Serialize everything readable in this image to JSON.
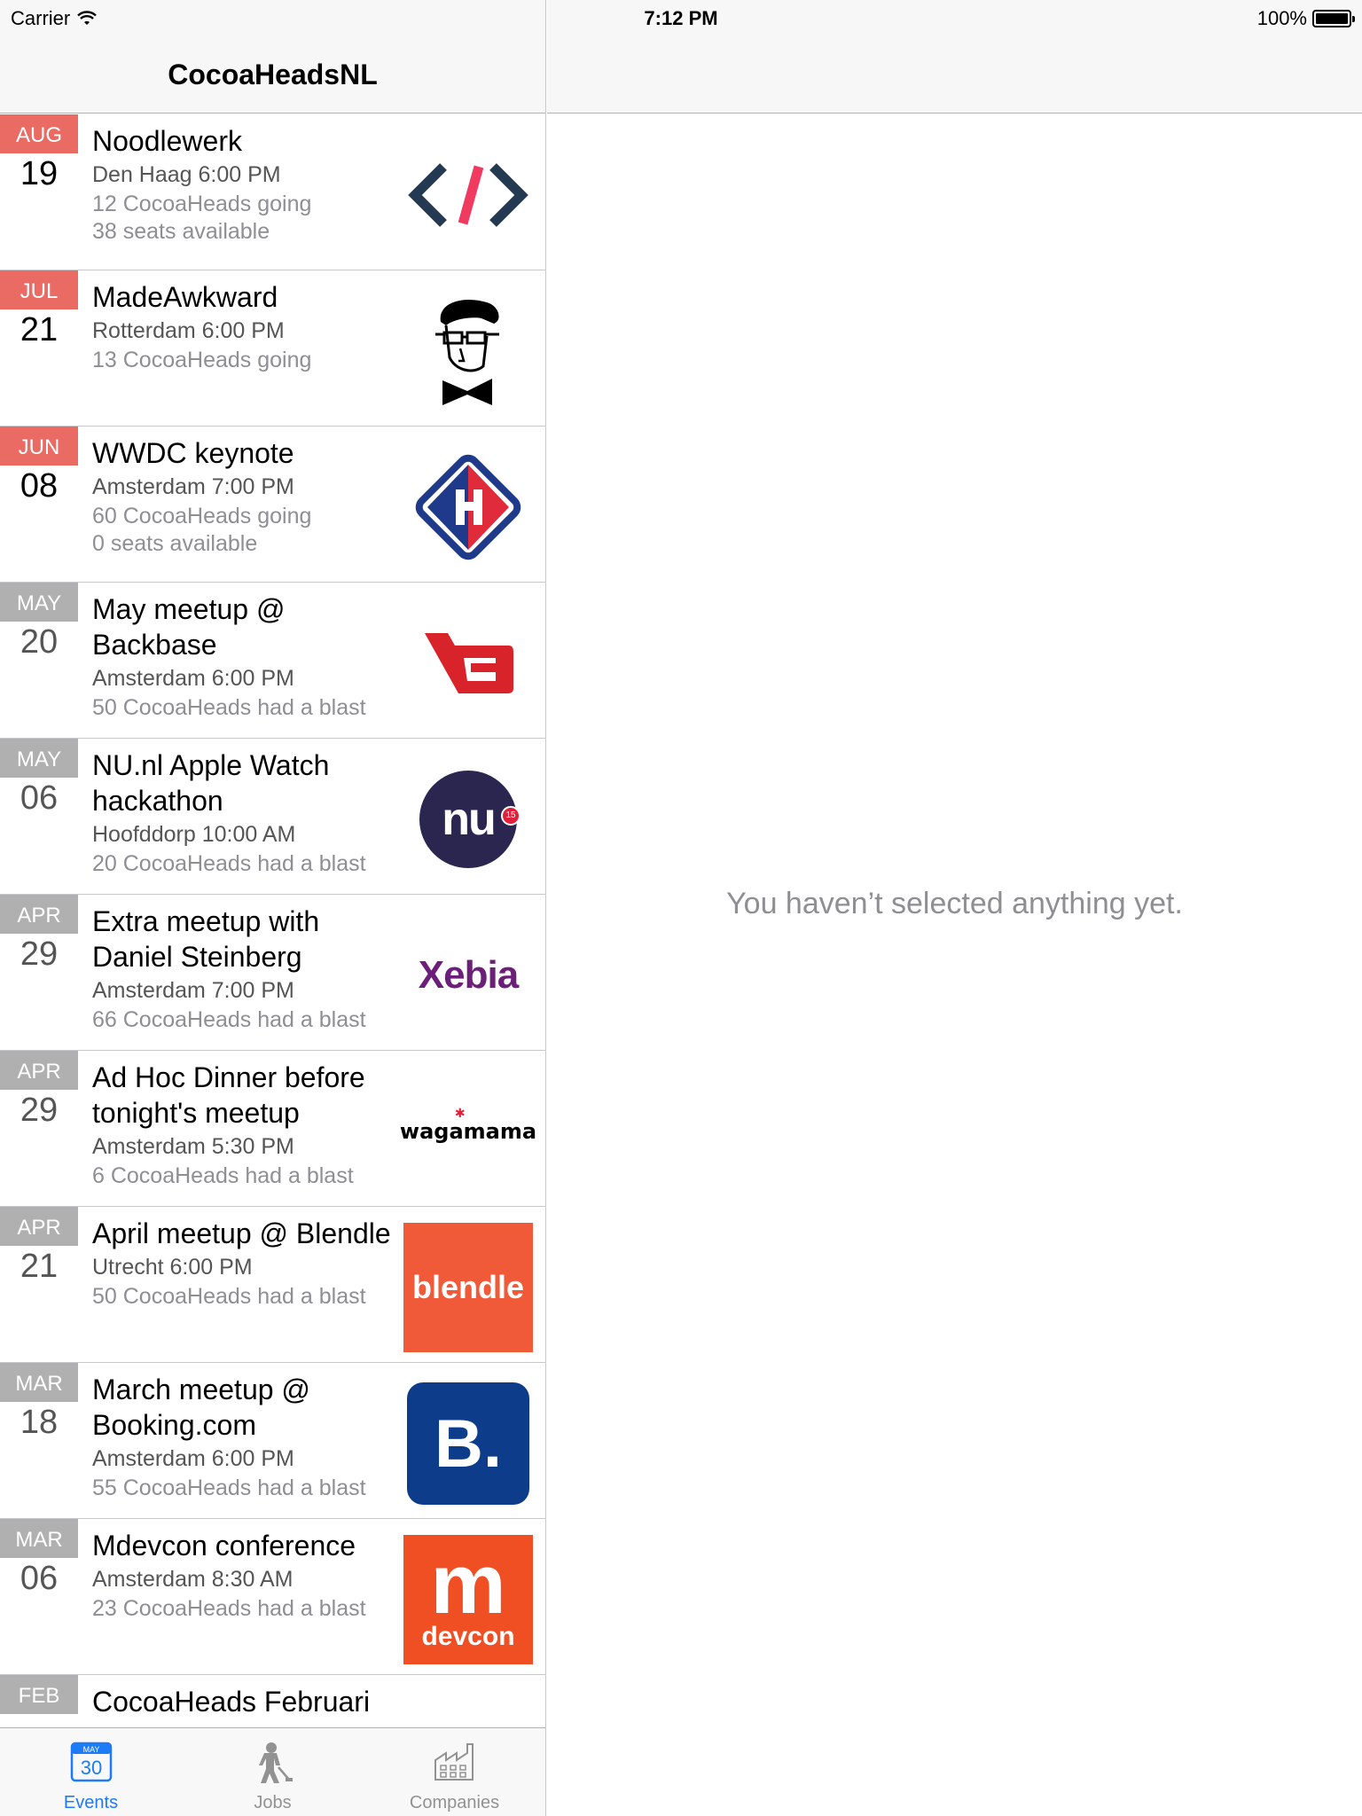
{
  "status_bar": {
    "carrier": "Carrier",
    "time": "7:12 PM",
    "battery": "100%"
  },
  "master": {
    "nav_title": "CocoaHeadsNL",
    "events": [
      {
        "month": "AUG",
        "day": "19",
        "past": false,
        "title": "Noodlewerk",
        "where": "Den Haag 6:00 PM",
        "going": "12 CocoaHeads going",
        "seats": "38 seats available",
        "logo": "code-brackets-logo"
      },
      {
        "month": "JUL",
        "day": "21",
        "past": false,
        "title": "MadeAwkward",
        "where": "Rotterdam 6:00 PM",
        "going": "13 CocoaHeads going",
        "seats": "",
        "logo": "awkward-face-logo"
      },
      {
        "month": "JUN",
        "day": "08",
        "past": false,
        "title": "WWDC keynote",
        "where": "Amsterdam 7:00 PM",
        "going": "60 CocoaHeads going",
        "seats": "0 seats available",
        "logo": "diamond-logo"
      },
      {
        "month": "MAY",
        "day": "20",
        "past": true,
        "title": "May meetup @ Backbase",
        "where": "Amsterdam 6:00 PM",
        "going": "50 CocoaHeads had a blast",
        "seats": "",
        "logo": "backbase-logo"
      },
      {
        "month": "MAY",
        "day": "06",
        "past": true,
        "title": "NU.nl Apple Watch hackathon",
        "where": "Hoofddorp 10:00 AM",
        "going": "20 CocoaHeads had a blast",
        "seats": "",
        "logo": "nu-logo"
      },
      {
        "month": "APR",
        "day": "29",
        "past": true,
        "title": "Extra meetup with Daniel Steinberg",
        "where": "Amsterdam 7:00 PM",
        "going": "66 CocoaHeads had a blast",
        "seats": "",
        "logo": "xebia-logo"
      },
      {
        "month": "APR",
        "day": "29",
        "past": true,
        "title": "Ad Hoc Dinner before tonight's meetup",
        "where": "Amsterdam 5:30 PM",
        "going": "6 CocoaHeads had a blast",
        "seats": "",
        "logo": "wagamama-logo"
      },
      {
        "month": "APR",
        "day": "21",
        "past": true,
        "title": "April meetup @ Blendle",
        "where": "Utrecht 6:00 PM",
        "going": "50 CocoaHeads had a blast",
        "seats": "",
        "logo": "blendle-logo"
      },
      {
        "month": "MAR",
        "day": "18",
        "past": true,
        "title": "March meetup @ Booking.com",
        "where": "Amsterdam 6:00 PM",
        "going": "55 CocoaHeads had a blast",
        "seats": "",
        "logo": "booking-logo"
      },
      {
        "month": "MAR",
        "day": "06",
        "past": true,
        "title": "Mdevcon conference",
        "where": "Amsterdam 8:30 AM",
        "going": "23 CocoaHeads had a blast",
        "seats": "",
        "logo": "mdevcon-logo"
      },
      {
        "month": "FEB",
        "day": "",
        "past": true,
        "title": "CocoaHeads Februari",
        "where": "",
        "going": "",
        "seats": "",
        "logo": "partial-logo"
      }
    ],
    "logo_text": {
      "nu": "nu",
      "nu_badge": "15",
      "xebia": "Xebia",
      "wagamama": "wagamama",
      "blendle": "blendle",
      "booking": "B.",
      "mdevcon_m": "m",
      "mdevcon_sub": "devcon"
    }
  },
  "tabbar": {
    "tabs": [
      {
        "label": "Events",
        "active": true,
        "icon": "calendar-icon",
        "icon_month": "MAY",
        "icon_day": "30"
      },
      {
        "label": "Jobs",
        "active": false,
        "icon": "worker-icon"
      },
      {
        "label": "Companies",
        "active": false,
        "icon": "factory-icon"
      }
    ]
  },
  "detail": {
    "empty_message": "You haven’t selected anything yet."
  },
  "colors": {
    "upcoming_month": "#ea6b64",
    "past_month": "#b0b0b0",
    "tint": "#1d7bf6"
  }
}
